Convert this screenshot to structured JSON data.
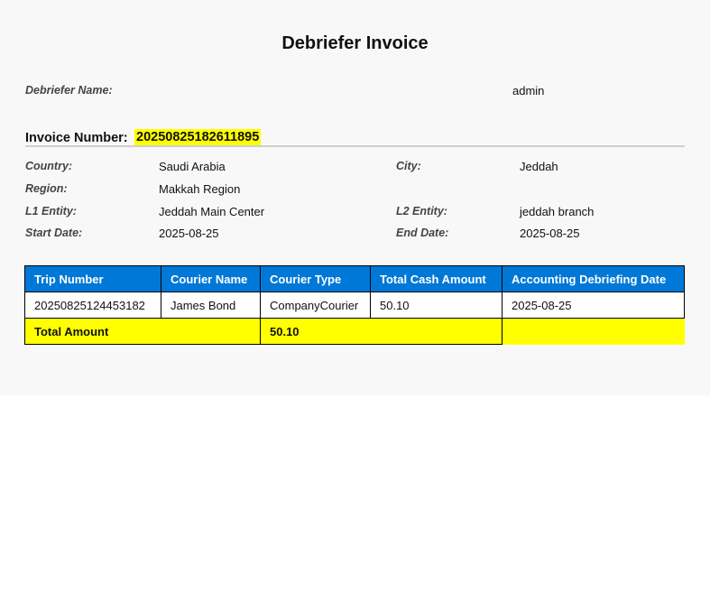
{
  "title": "Debriefer Invoice",
  "debriefer": {
    "label": "Debriefer Name:",
    "value": "admin"
  },
  "invoice": {
    "label": "Invoice Number:",
    "number": "20250825182611895"
  },
  "details": {
    "country": {
      "label": "Country:",
      "value": "Saudi Arabia"
    },
    "city": {
      "label": "City:",
      "value": "Jeddah"
    },
    "region": {
      "label": "Region:",
      "value": "Makkah Region"
    },
    "l1_entity": {
      "label": "L1 Entity:",
      "value": "Jeddah Main Center"
    },
    "l2_entity": {
      "label": "L2 Entity:",
      "value": "jeddah branch"
    },
    "start_date": {
      "label": "Start Date:",
      "value": "2025-08-25"
    },
    "end_date": {
      "label": "End Date:",
      "value": "2025-08-25"
    }
  },
  "table": {
    "headers": [
      "Trip Number",
      "Courier Name",
      "Courier Type",
      "Total Cash Amount",
      "Accounting Debriefing Date"
    ],
    "rows": [
      [
        "20250825124453182",
        "James Bond",
        "CompanyCourier",
        "50.10",
        "2025-08-25"
      ]
    ],
    "total": {
      "label": "Total Amount",
      "value": "50.10"
    }
  },
  "colors": {
    "header_bg": "#0078d7",
    "highlight": "#ffff00"
  }
}
